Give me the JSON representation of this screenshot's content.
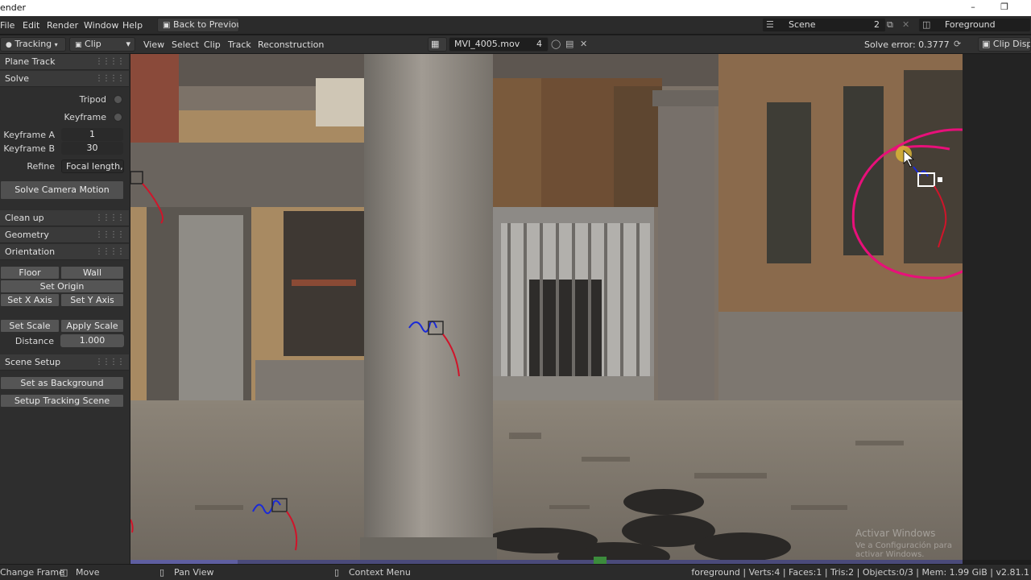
{
  "window": {
    "title": "ender"
  },
  "menubar": {
    "items": [
      "File",
      "Edit",
      "Render",
      "Window",
      "Help"
    ],
    "back_button": "Back to Previous",
    "scene_label": "Scene",
    "scene_users": "2",
    "view_layer": "Foreground"
  },
  "clip_header": {
    "mode_select": "Tracking",
    "view_select": "Clip",
    "menus": [
      "View",
      "Select",
      "Clip",
      "Track",
      "Reconstruction"
    ],
    "clip_name": "MVI_4005.mov",
    "clip_users": "4",
    "solve_error": "Solve error: 0.3777",
    "display_label": "Clip Displ"
  },
  "sidebar": {
    "plane_track": "Plane Track",
    "solve": {
      "header": "Solve",
      "tripod": "Tripod",
      "keyframe": "Keyframe",
      "keyframe_a_label": "Keyframe A",
      "keyframe_a_value": "1",
      "keyframe_b_label": "Keyframe B",
      "keyframe_b_value": "30",
      "refine_label": "Refine",
      "refine_value": "Focal length,...",
      "solve_button": "Solve Camera Motion"
    },
    "clean_up": "Clean up",
    "geometry": "Geometry",
    "orientation": {
      "header": "Orientation",
      "floor": "Floor",
      "wall": "Wall",
      "set_origin": "Set Origin",
      "set_x": "Set X Axis",
      "set_y": "Set Y Axis",
      "set_scale": "Set Scale",
      "apply_scale": "Apply Scale",
      "distance_label": "Distance",
      "distance_value": "1.000"
    },
    "scene_setup": {
      "header": "Scene Setup",
      "set_background": "Set as Background",
      "setup_tracking": "Setup Tracking Scene"
    }
  },
  "statusbar": {
    "change_frame": "Change Frame",
    "move": "Move",
    "pan_view": "Pan View",
    "context_menu": "Context Menu",
    "stats": "foreground | Verts:4 | Faces:1 | Tris:2 | Objects:0/3 | Mem: 1.99 GiB | v2.81.1"
  },
  "watermark": {
    "line1": "Activar Windows",
    "line2": "Ve a Configuración para activar Windows."
  },
  "colors": {
    "annotation": "#e8107a",
    "track_path_red": "#d0142a",
    "track_path_blue": "#1a2ad8"
  }
}
